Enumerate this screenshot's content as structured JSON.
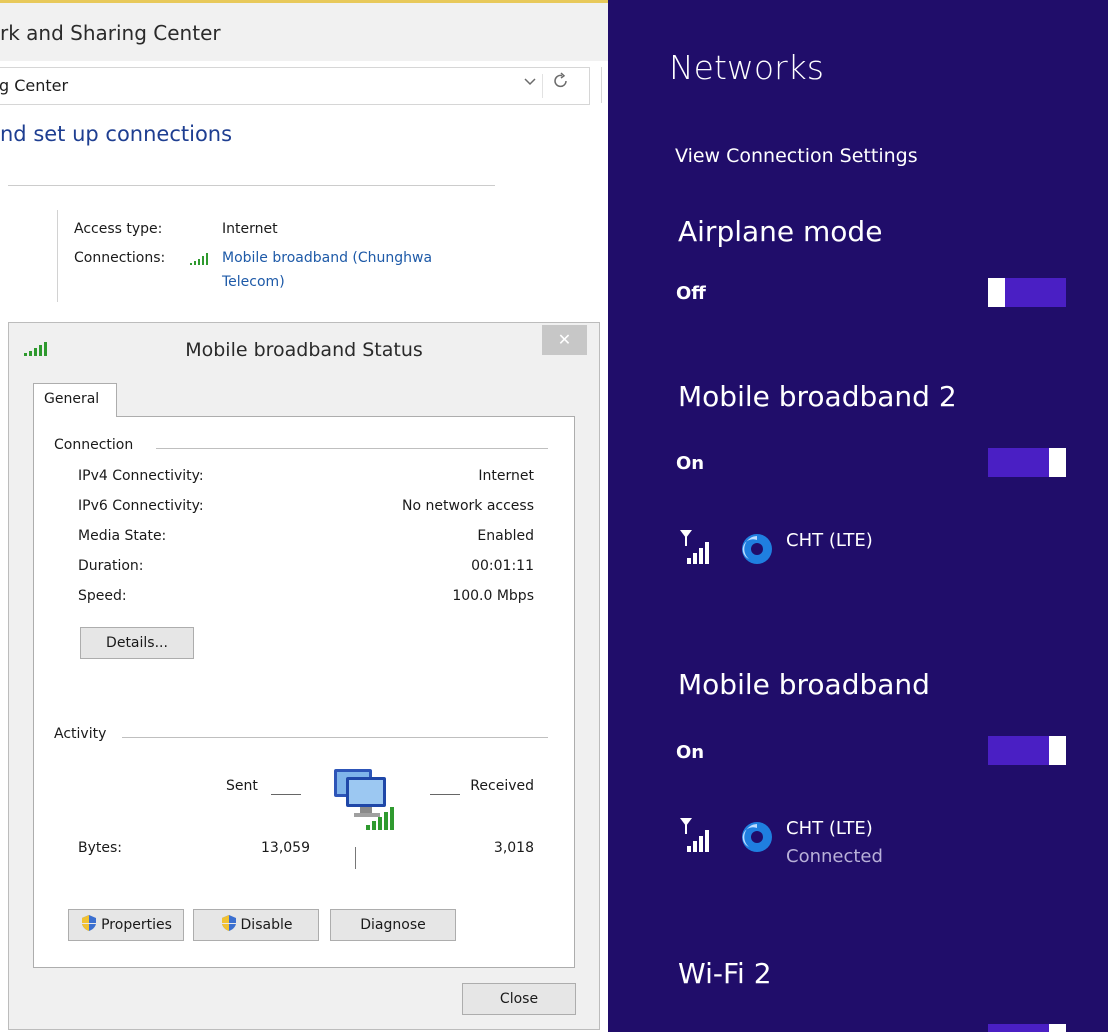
{
  "control_panel": {
    "title": "rk and Sharing Center",
    "address_text": "g Center",
    "heading": "nd set up connections",
    "access_type_label": "Access type:",
    "access_type_value": "Internet",
    "connections_label": "Connections:",
    "connection_link_line1": "Mobile broadband (Chunghwa",
    "connection_link_line2": "Telecom)"
  },
  "dialog": {
    "title": "Mobile broadband Status",
    "close_x": "✕",
    "tab": "General",
    "connection": {
      "heading": "Connection",
      "rows": [
        {
          "label": "IPv4 Connectivity:",
          "value": "Internet"
        },
        {
          "label": "IPv6 Connectivity:",
          "value": "No network access"
        },
        {
          "label": "Media State:",
          "value": "Enabled"
        },
        {
          "label": "Duration:",
          "value": "00:01:11"
        },
        {
          "label": "Speed:",
          "value": "100.0 Mbps"
        }
      ],
      "details_button": "Details..."
    },
    "activity": {
      "heading": "Activity",
      "sent_label": "Sent",
      "received_label": "Received",
      "bytes_label": "Bytes:",
      "bytes_sent": "13,059",
      "bytes_received": "3,018"
    },
    "buttons": {
      "properties": "Properties",
      "disable": "Disable",
      "diagnose": "Diagnose",
      "close": "Close"
    }
  },
  "networks": {
    "title": "Networks",
    "view_settings": "View Connection Settings",
    "airplane": {
      "title": "Airplane mode",
      "state": "Off",
      "on": false
    },
    "mobile_broadband_2": {
      "title": "Mobile broadband 2",
      "state": "On",
      "on": true,
      "connection": "CHT (LTE)"
    },
    "mobile_broadband": {
      "title": "Mobile broadband",
      "state": "On",
      "on": true,
      "connection": "CHT (LTE)",
      "status": "Connected"
    },
    "wifi_2": {
      "title": "Wi-Fi 2"
    }
  },
  "colors": {
    "charm_bg": "#200d6a",
    "toggle_track": "#4a1fc4",
    "link": "#1e5aa8",
    "signal_green": "#2f9a2f"
  },
  "icons": [
    "signal-bars-icon",
    "shield-icon",
    "network-computer-icon",
    "antenna-signal-icon",
    "carrier-logo-icon",
    "refresh-icon",
    "chevron-down-icon"
  ]
}
